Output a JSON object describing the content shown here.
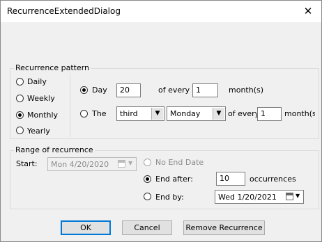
{
  "window": {
    "title": "RecurrenceExtendedDialog",
    "close_glyph": "✕"
  },
  "pattern": {
    "legend": "Recurrence pattern",
    "options": [
      {
        "label": "Daily",
        "selected": false
      },
      {
        "label": "Weekly",
        "selected": false
      },
      {
        "label": "Monthly",
        "selected": true
      },
      {
        "label": "Yearly",
        "selected": false
      }
    ],
    "day_option": {
      "label": "Day",
      "selected": true,
      "day_value": "20",
      "of_every_label": "of every",
      "months_value": "1",
      "months_label": "month(s)"
    },
    "the_option": {
      "label": "The",
      "selected": false,
      "ordinal": "third",
      "weekday": "Monday",
      "of_every_label": "of every",
      "months_value": "1",
      "months_label": "month(s)"
    }
  },
  "range": {
    "legend": "Range of recurrence",
    "start_label": "Start:",
    "start_date": "Mon    4/20/2020",
    "no_end": {
      "label": "No End Date",
      "selected": false,
      "disabled": true
    },
    "end_after": {
      "label": "End after:",
      "selected": true,
      "value": "10",
      "unit": "occurrences"
    },
    "end_by": {
      "label": "End by:",
      "selected": false,
      "date": "Wed    1/20/2021"
    }
  },
  "buttons": {
    "ok": "OK",
    "cancel": "Cancel",
    "remove": "Remove Recurrence"
  }
}
